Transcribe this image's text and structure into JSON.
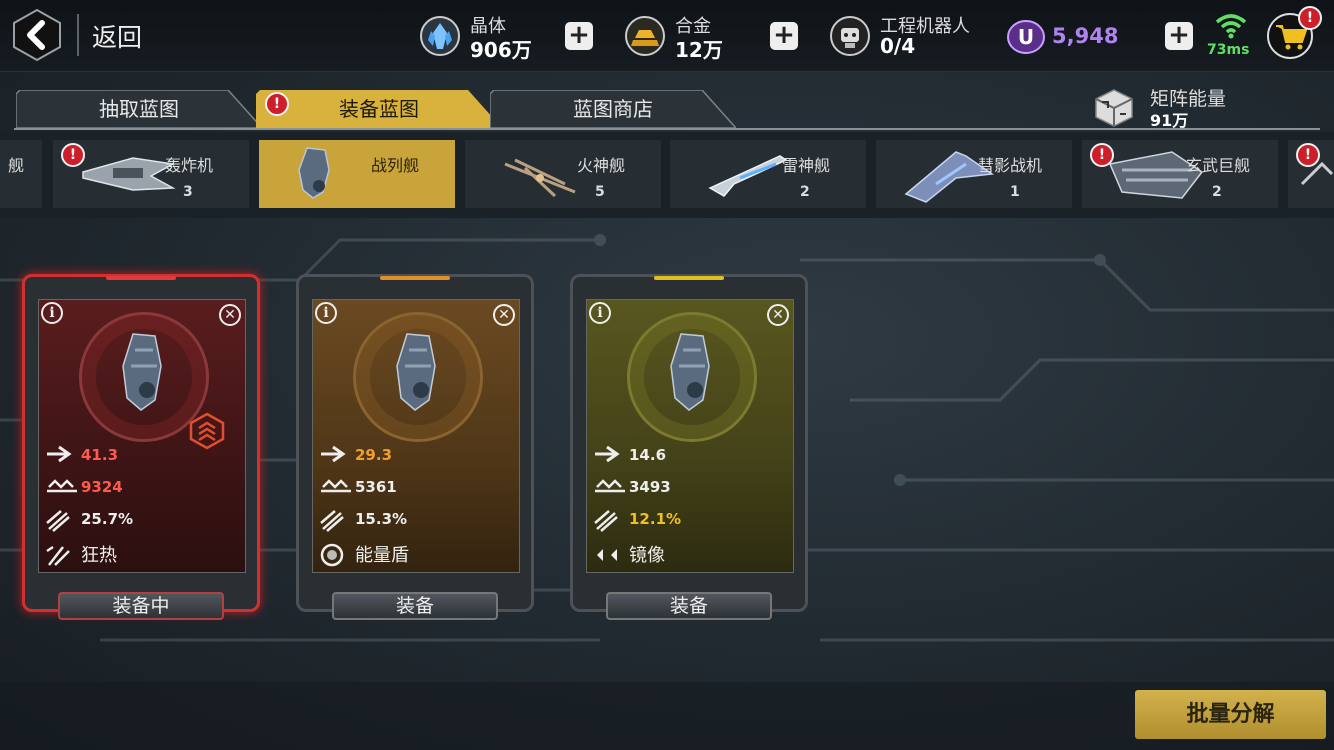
{
  "header": {
    "back_label": "返回",
    "resources": [
      {
        "name": "晶体",
        "value": "906万"
      },
      {
        "name": "合金",
        "value": "12万"
      },
      {
        "name": "工程机器人",
        "value": "0/4"
      }
    ],
    "currency_value": "5,948",
    "ping": "73ms"
  },
  "tabs": [
    {
      "label": "抽取蓝图"
    },
    {
      "label": "装备蓝图"
    },
    {
      "label": "蓝图商店"
    }
  ],
  "matrix": {
    "label": "矩阵能量",
    "value": "91万"
  },
  "ship_types": [
    {
      "name": "轰炸机",
      "count": "3"
    },
    {
      "name": "战列舰",
      "count": ""
    },
    {
      "name": "火神舰",
      "count": "5"
    },
    {
      "name": "雷神舰",
      "count": "2"
    },
    {
      "name": "彗影战机",
      "count": "1"
    },
    {
      "name": "玄武巨舰",
      "count": "2"
    }
  ],
  "cards": [
    {
      "speed": "41.3",
      "hp": "9324",
      "rate": "25.7%",
      "skill": "狂热",
      "button": "装备中",
      "color": "#d03030"
    },
    {
      "speed": "29.3",
      "hp": "5361",
      "rate": "15.3%",
      "skill": "能量盾",
      "button": "装备",
      "color": "#e0902a"
    },
    {
      "speed": "14.6",
      "hp": "3493",
      "rate": "12.1%",
      "skill": "镜像",
      "button": "装备",
      "color": "#e0c020"
    }
  ],
  "colors": {
    "accent_gold": "#c9a43a",
    "badge_red": "#cc1f2a",
    "currency_purple": "#b083f0",
    "ping_green": "#5fe065"
  },
  "batch_button": "批量分解"
}
